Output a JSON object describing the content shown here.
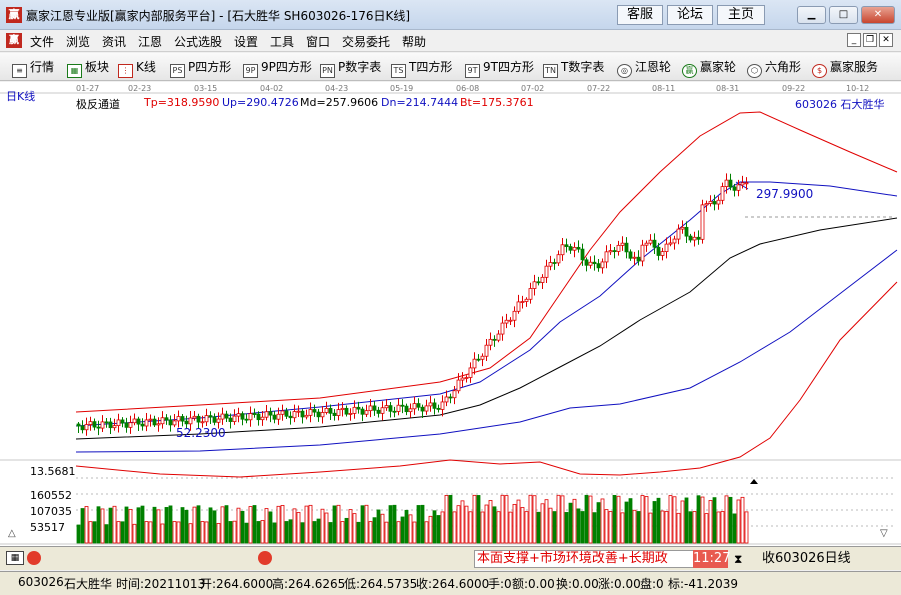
{
  "window": {
    "title": "赢家江恩专业版[赢家内部服务平台] - [石大胜华  SH603026-176日K线]",
    "app_icon": "赢",
    "links": [
      "客服",
      "论坛",
      "主页"
    ],
    "controls": [
      "minimize-icon",
      "maximize-icon",
      "close-icon"
    ]
  },
  "menubar": {
    "icon": "赢",
    "items": [
      "文件",
      "浏览",
      "资讯",
      "江恩",
      "公式选股",
      "设置",
      "工具",
      "窗口",
      "交易委托",
      "帮助"
    ]
  },
  "toolbar": {
    "items": [
      {
        "icon": "list-icon",
        "glyph": "≡",
        "label": "行情"
      },
      {
        "icon": "grid-icon",
        "glyph": "▦",
        "label": "板块"
      },
      {
        "icon": "candle-icon",
        "glyph": "⋮",
        "label": "K线"
      },
      {
        "icon": "ps-icon",
        "glyph": "PS",
        "label": "P四方形"
      },
      {
        "icon": "9ps-icon",
        "glyph": "9P",
        "label": "9P四方形"
      },
      {
        "icon": "pn-icon",
        "glyph": "PN",
        "label": "P数字表"
      },
      {
        "icon": "ts-icon",
        "glyph": "TS",
        "label": "T四方形"
      },
      {
        "icon": "9ts-icon",
        "glyph": "9T",
        "label": "9T四方形"
      },
      {
        "icon": "tn-icon",
        "glyph": "TN",
        "label": "T数字表"
      },
      {
        "icon": "gann-wheel-icon",
        "glyph": "◎",
        "label": "江恩轮"
      },
      {
        "icon": "winner-wheel-icon",
        "glyph": "赢",
        "label": "赢家轮"
      },
      {
        "icon": "hexagon-icon",
        "glyph": "⬡",
        "label": "六角形"
      },
      {
        "icon": "dollar-icon",
        "glyph": "$",
        "label": "赢家服务"
      }
    ]
  },
  "chart": {
    "period_label": "日K线",
    "dates": [
      "01-27",
      "02-23",
      "03-15",
      "04-02",
      "04-23",
      "05-19",
      "06-08",
      "07-02",
      "07-22",
      "08-11",
      "08-31",
      "09-22",
      "10-12"
    ],
    "indicator": {
      "name": "极反通道",
      "tp": "Tp=318.9590",
      "up": "Up=290.4726",
      "md": "Md=257.9606",
      "dn": "Dn=214.7444",
      "bt": "Bt=175.3761"
    },
    "stock_label": "603026  石大胜华",
    "high_marker": "297.9900",
    "low_marker": "52.2300",
    "bottom_price": "13.5681",
    "volume_ticks": [
      "160552",
      "107035",
      "53517"
    ],
    "colors": {
      "up": "#e00000",
      "down": "#008000",
      "channel_outer": "#e00000",
      "channel_inner": "#1010c0",
      "channel_mid": "#000000",
      "indicator_name": "#000000",
      "tp": "#e00000",
      "up_val": "#1010c0",
      "md": "#000000",
      "dn": "#1010c0",
      "bt": "#e00000"
    }
  },
  "cmdbar": {
    "ticker_text": "本面支撑+市场环境改善+长期政",
    "time_text": "11:27",
    "command_text": "收603026日线"
  },
  "statusbar": {
    "code": "603026",
    "name": "石大胜华",
    "time": "时间:20211013",
    "open": "开:264.6000",
    "high": "高:264.6265",
    "low": "低:264.5735",
    "close": "收:264.6000",
    "hand": "手:0",
    "amount": "额:0.00",
    "turnover": "换:0.00",
    "change": "涨:0.00",
    "mid": "盘:0",
    "mark": "标:-41.2039"
  }
}
